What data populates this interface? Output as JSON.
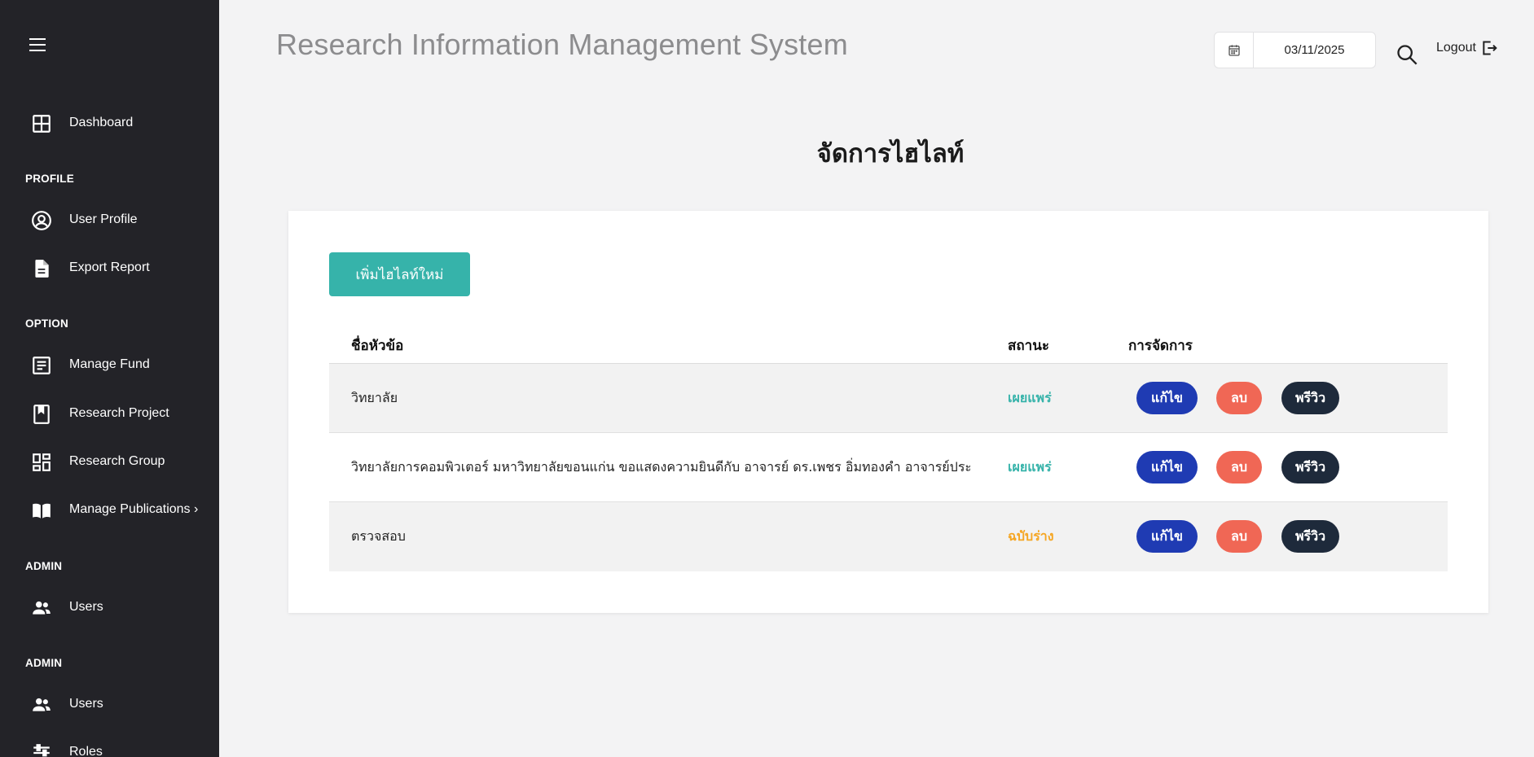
{
  "sidebar": {
    "items": [
      {
        "label": "Dashboard"
      },
      {
        "label": "User Profile"
      },
      {
        "label": "Export Report"
      },
      {
        "label": "Manage Fund"
      },
      {
        "label": "Research Project"
      },
      {
        "label": "Research Group"
      },
      {
        "label": "Manage Publications ›"
      },
      {
        "label": "Users"
      },
      {
        "label": "Users"
      },
      {
        "label": "Roles"
      }
    ],
    "sections": [
      "PROFILE",
      "OPTION",
      "ADMIN",
      "ADMIN"
    ]
  },
  "header": {
    "title": "Research Information Management System",
    "date": "03/11/2025",
    "logout": "Logout"
  },
  "page": {
    "title": "จัดการไฮไลท์",
    "add_button": "เพิ่มไฮไลท์ใหม่"
  },
  "table": {
    "headers": [
      "ชื่อหัวข้อ",
      "สถานะ",
      "การจัดการ"
    ],
    "rows": [
      {
        "title": "วิทยาลัย",
        "status": "เผยแพร่",
        "status_color": "#36b3aa"
      },
      {
        "title": "วิทยาลัยการคอมพิวเตอร์ มหาวิทยาลัยขอนแก่น ขอแสดงความยินดีกับ อาจารย์ ดร.เพชร อิ่มทองคำ อาจารย์ประจำวิ...",
        "status": "เผยแพร่",
        "status_color": "#36b3aa"
      },
      {
        "title": "ตรวจสอบ",
        "status": "ฉบับร่าง",
        "status_color": "#f5a623"
      }
    ],
    "actions": {
      "edit": "แก้ไข",
      "delete": "ลบ",
      "preview": "พรีวิว"
    }
  },
  "colors": {
    "sidebar_bg": "#232328",
    "accent": "#36b3aa",
    "edit": "#1f3bb3",
    "delete": "#f06755",
    "preview": "#1e2a3b"
  }
}
